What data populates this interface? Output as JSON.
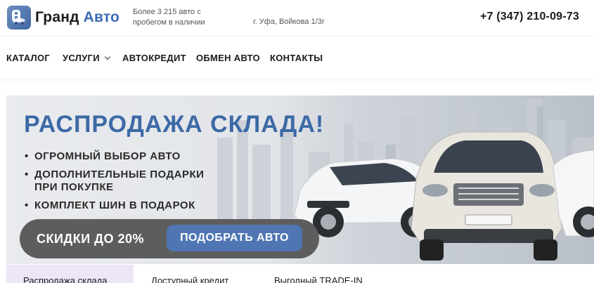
{
  "header": {
    "brand_part1": "Гранд",
    "brand_part2": "Авто",
    "tagline_line1": "Более 3 215 авто с",
    "tagline_line2": "пробегом в наличии",
    "address": "г. Уфа, Войкова 1/3г",
    "phone": "+7 (347) 210-09-73"
  },
  "nav": {
    "items": [
      {
        "label": "КАТАЛОГ"
      },
      {
        "label": "УСЛУГИ"
      },
      {
        "label": "АВТОКРЕДИТ"
      },
      {
        "label": "ОБМЕН АВТО"
      },
      {
        "label": "КОНТАКТЫ"
      }
    ]
  },
  "banner": {
    "title": "РАСПРОДАЖА СКЛАДА!",
    "bullets": [
      {
        "dot": "•",
        "line1": "ОГРОМНЫЙ ВЫБОР АВТО",
        "line2": ""
      },
      {
        "dot": "•",
        "line1": "ДОПОЛНИТЕЛЬНЫЕ ПОДАРКИ",
        "line2": "ПРИ ПОКУПКЕ"
      },
      {
        "dot": "•",
        "line1": "КОМПЛЕКТ ШИН В ПОДАРОК",
        "line2": ""
      }
    ],
    "discount_label": "СКИДКИ ДО 20%",
    "cta_label": "ПОДОБРАТЬ АВТО"
  },
  "tabs": [
    {
      "label": "Распродажа склада",
      "active": true
    },
    {
      "label": "Доступный кредит",
      "active": false
    },
    {
      "label": "Выгодный TRADE-IN",
      "active": false
    }
  ],
  "colors": {
    "accent": "#3b6bb3",
    "banner_title": "#3d6aa6",
    "cta_bg": "#4f75b3",
    "pill_bg": "#5d5d5d",
    "active_tab_bg": "#ece6f6"
  },
  "icons": {
    "logo": "car-key-logo-icon",
    "services_dropdown": "chevron-down-icon"
  }
}
